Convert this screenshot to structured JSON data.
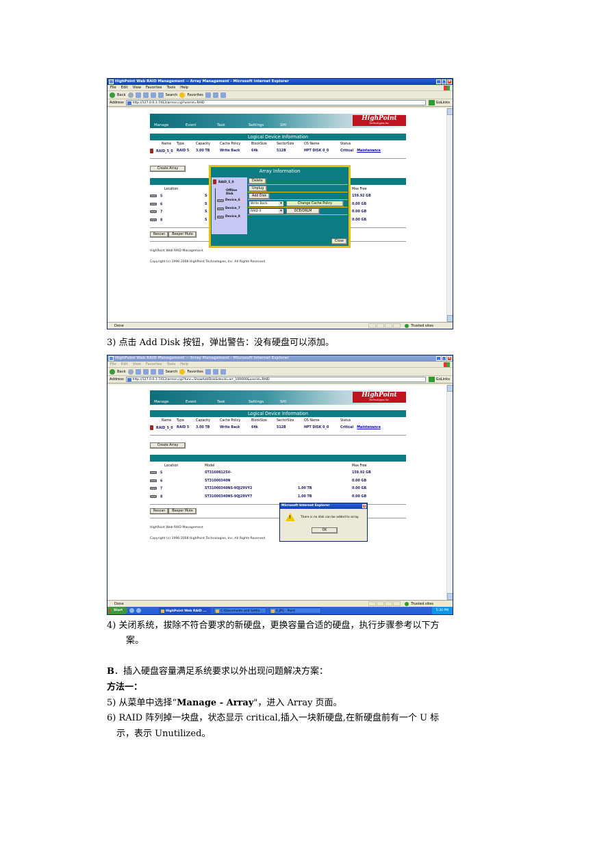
{
  "window1": {
    "title": "HighPoint Web RAID Management -- Array Management - Microsoft Internet Explorer",
    "menu": [
      "File",
      "Edit",
      "View",
      "Favorites",
      "Tools",
      "Help"
    ],
    "toolbar": {
      "back": "Back",
      "search": "Search",
      "favorites": "Favorites"
    },
    "address_label": "Address",
    "address": "http://127.0.0.1:7412/armsn.cgi?userid=RAID",
    "go": "Go",
    "links": "Links",
    "status_left": "Done",
    "status_right": "Trusted sites"
  },
  "window2": {
    "title": "HighPoint Web RAID Management -- Array Management - Microsoft Internet Explorer",
    "menu": [
      "File",
      "Edit",
      "View",
      "Favorites",
      "Tools",
      "Help"
    ],
    "toolbar": {
      "back": "Back",
      "search": "Search",
      "favorites": "Favorites"
    },
    "address_label": "Address",
    "address": "http://127.0.0.1:7412/armsn.cgi?func=ShowAddDisk&devid=arr_100000&userid=RAID",
    "go": "Go",
    "links": "Links",
    "status_left": "Done",
    "status_right": "Trusted sites",
    "taskbar": {
      "start": "Start",
      "tasks": [
        "HighPoint Web RAID ...",
        "C:\\Documents and Settin...",
        "6.JPG - Paint"
      ],
      "clock": "5:30 PM"
    }
  },
  "raid_page": {
    "nav": [
      "Manage",
      "Event",
      "Task",
      "Settings",
      "SHI"
    ],
    "logo": "HighPoint",
    "logo_sub": "Technologies,Inc.",
    "ldi_title": "Logical Device Information",
    "ldi_headers": [
      "Name",
      "Type",
      "Capacity",
      "Cache Policy",
      "BlockSize",
      "SectorSize",
      "OS Name",
      "Status"
    ],
    "ldi_row": [
      "RAID_5_0",
      "RAID 5",
      "3.00 TB",
      "Write Back",
      "64k",
      "512B",
      "HPT DISK 0_0",
      "Critical"
    ],
    "maintenance": "Maintenance",
    "create_array": "Create Array",
    "device_headers_1": [
      "Location",
      "",
      "Max Free"
    ],
    "device_headers_2": [
      "Location",
      "Model",
      "Max Free"
    ],
    "devices_1": [
      {
        "loc": "5",
        "model": "S",
        "max_free": "159.92 GB"
      },
      {
        "loc": "6",
        "model": "S",
        "max_free": "0.00 GB"
      },
      {
        "loc": "7",
        "model": "S",
        "max_free": "0.00 GB"
      },
      {
        "loc": "8",
        "model": "S",
        "max_free": "0.00 GB"
      }
    ],
    "devices_2": [
      {
        "loc": "5",
        "model": "ST3160812SV-",
        "cap": "",
        "max_free": "159.92 GB"
      },
      {
        "loc": "6",
        "model": "ST31000340N",
        "cap": "",
        "max_free": "0.00 GB"
      },
      {
        "loc": "7",
        "model": "ST31000340NS-9QJ29VY2",
        "cap": "1.00 TB",
        "max_free": "0.00 GB"
      },
      {
        "loc": "8",
        "model": "ST31000340NS-9QJ29VY7",
        "cap": "1.00 TB",
        "max_free": "0.00 GB"
      }
    ],
    "rescan": "Rescan",
    "beeper_mute": "Beeper Mute",
    "footer1": "HighPoint Web RAID Management",
    "footer2": "Copyright (c) 1996-2008 HighPoint Technologies, Inc. All Rights Reserved"
  },
  "array_info": {
    "title": "Array Information",
    "tree": [
      "RAID_5_0",
      "Offline Disk",
      "Device_6",
      "Device_7",
      "Device_8"
    ],
    "delete": "Delete",
    "unplug": "Unplug",
    "add_disk": "Add Disk",
    "cache_select": "Write Back",
    "change_cache": "Change Cache Policy",
    "raid_select": "RAID 0",
    "oce": "OCE/ORLM",
    "close": "Close"
  },
  "dialog": {
    "title": "Microsoft Internet Explorer",
    "message": "There is no disk can be added to array.",
    "ok": "OK"
  },
  "doc": {
    "step3": "3)   点击 Add Disk  按钮，弹出警告：没有硬盘可以添加。",
    "step4_line1": "4)   关闭系统，拔除不符合要求的新硬盘，更换容量合适的硬盘，执行步骤参考以下方",
    "step4_line2": "案。",
    "section_b_bold": "B",
    "section_b": "．插入硬盘容量满足系统要求以外出现问题解决方案：",
    "method1": "方法一：",
    "step5_prefix": "5)     从菜单中选择“",
    "step5_bold": "Manage - Array",
    "step5_suffix": "\"，进入 Array 页面。",
    "step6_line1": "6)     RAID 阵列掉一块盘，状态显示 critical,插入一块新硬盘,在新硬盘前有一个 U 标",
    "step6_line2": "示，表示 Unutilized。"
  }
}
